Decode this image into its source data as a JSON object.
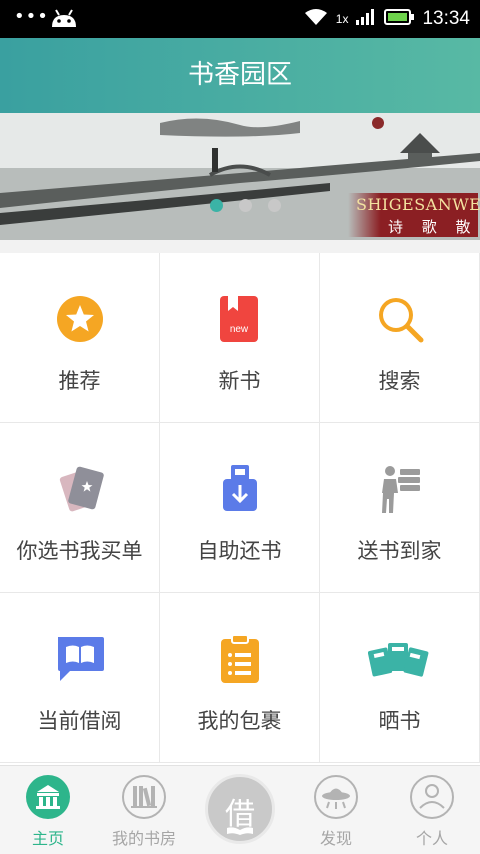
{
  "status_bar": {
    "time": "13:34",
    "network": "1x",
    "dots": "•••"
  },
  "header": {
    "title": "书香园区"
  },
  "banner": {
    "brand_line": "SHIGESANWEN",
    "subtitle": "诗 歌 散 文",
    "active_slide": 1,
    "slide_count": 3
  },
  "grid": {
    "items": [
      {
        "label": "推荐",
        "icon": "star-icon"
      },
      {
        "label": "新书",
        "icon": "new-book-icon"
      },
      {
        "label": "搜索",
        "icon": "search-icon"
      },
      {
        "label": "你选书我买单",
        "icon": "cards-star-icon"
      },
      {
        "label": "自助还书",
        "icon": "return-box-icon"
      },
      {
        "label": "送书到家",
        "icon": "delivery-person-icon"
      },
      {
        "label": "当前借阅",
        "icon": "open-book-icon"
      },
      {
        "label": "我的包裹",
        "icon": "clipboard-list-icon"
      },
      {
        "label": "晒书",
        "icon": "book-stack-icon"
      }
    ]
  },
  "bottom_nav": {
    "items": [
      {
        "label": "主页",
        "icon": "home-icon",
        "active": true
      },
      {
        "label": "我的书房",
        "icon": "bookshelf-icon",
        "active": false
      },
      {
        "label": "借",
        "icon": "borrow-icon",
        "active": false
      },
      {
        "label": "发现",
        "icon": "ufo-icon",
        "active": false
      },
      {
        "label": "个人",
        "icon": "person-icon",
        "active": false
      }
    ]
  },
  "colors": {
    "header_start": "#3aa0a0",
    "header_end": "#58b9a4",
    "active_green": "#2db58b",
    "orange": "#f5a623",
    "red": "#f0453f",
    "blue": "#5b7be8"
  }
}
